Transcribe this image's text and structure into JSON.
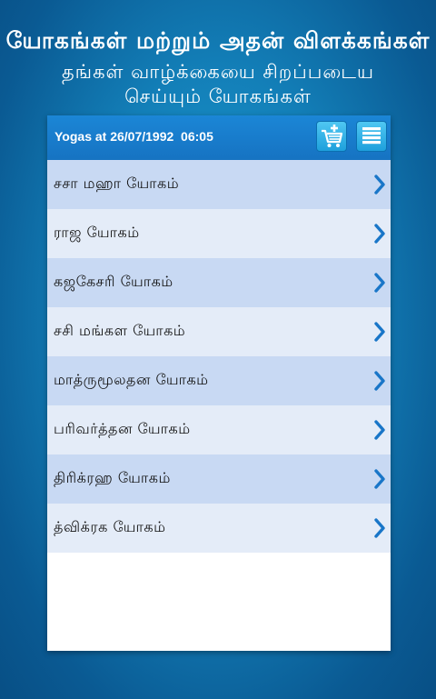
{
  "header": {
    "title": "யோகங்கள் மற்றும் அதன் விளக்கங்கள்",
    "subtitle_line1": "தங்கள் வாழ்க்கையை சிறப்படைய",
    "subtitle_line2": "செய்யும் யோகங்கள்"
  },
  "panel": {
    "title": "Yogas at 26/07/1992  06:05",
    "cart_icon": "cart-add-icon",
    "menu_icon": "list-menu-icon"
  },
  "yogas": [
    "சசா மஹா யோகம்",
    "ராஜ யோகம்",
    "கஜகேசரி யோகம்",
    "சசி மங்கள யோகம்",
    "மாத்ருமூலதன யோகம்",
    "பரிவர்த்தன யோகம்",
    "திரிக்ரஹ யோகம்",
    "த்விக்ரக யோகம்"
  ],
  "colors": {
    "row_odd": "#c8d9f3",
    "row_even": "#e4ecf8",
    "chevron": "#1976c8",
    "header_bar": "#1673c2"
  }
}
